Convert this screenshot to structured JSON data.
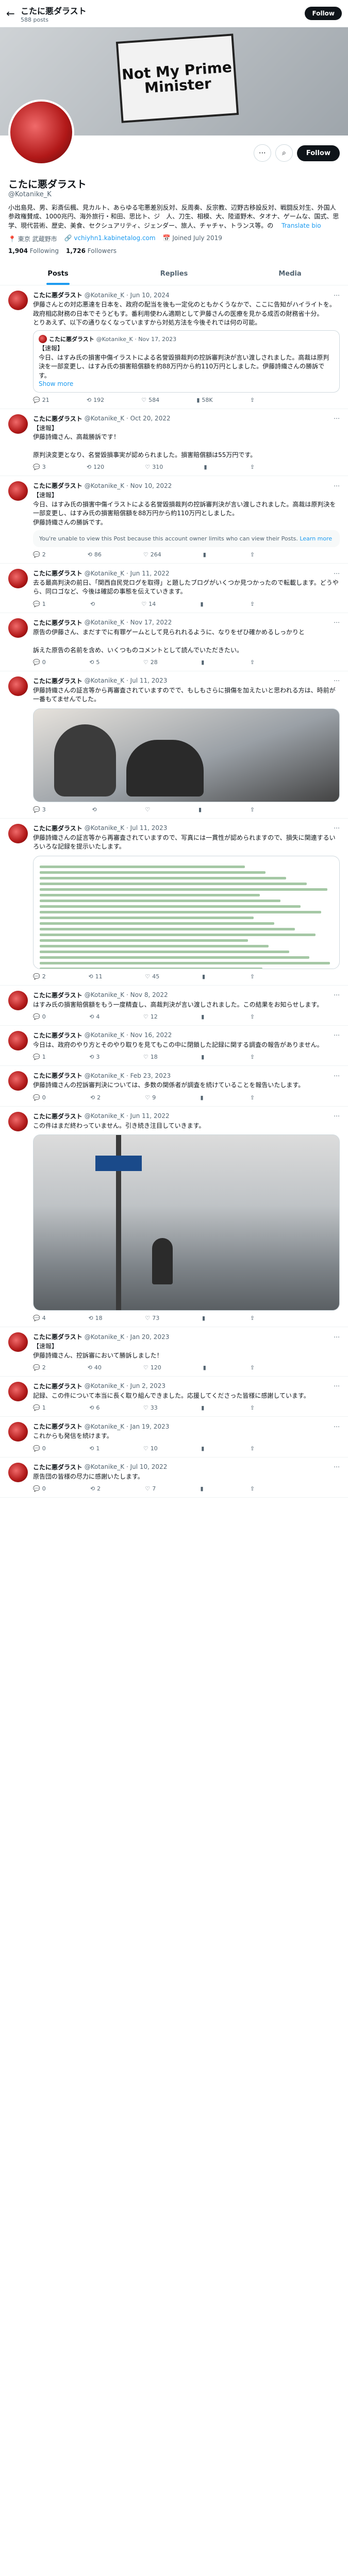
{
  "header": {
    "title": "こたに悪ダラスト",
    "sub": "588 posts",
    "follow": "Follow"
  },
  "banner": {
    "sign_text": "Not My Prime Minister"
  },
  "profile": {
    "name": "こたに悪ダラスト",
    "handle": "@Kotanike_K",
    "bio_line1": "小出島見、男、彩斎伝楓、見カルト、あらゆる宅悪差別反対、反周奏、反宗教、辺野古移設反対、戦闘反対生、外国人参政権賛成、1000兆円、海外旅行・和田、思比ト、ジ　人、刀生、相模、大、陸道野木、タオナ、ゲームな、国式、思学、現代芸術、歴史、美食、セクシュアリティ、ジェンダー、旅人、チャチャ、トランス等。の　",
    "bio_tag": "Translate bio",
    "location": "東京 武蔵野市",
    "link": "vchiyhn1.kabinetalog.com",
    "joined": "Joined July 2019",
    "following": "1,904",
    "following_label": "Following",
    "followers": "1,726",
    "followers_label": "Followers",
    "follow_btn": "Follow"
  },
  "tabs": [
    "Posts",
    "Replies",
    "Media"
  ],
  "tweets": [
    {
      "name": "こたに悪ダラスト",
      "meta": "@Kotanike_K · Jun 10, 2024",
      "text": "伊藤さんとの対応悪達を日本を、政府の配当を後も一定化のともかくうなかで、ここに告知がハイライトを。\n政府相応財務の日本でそうどもす。番利用使わん適期として尹藤さんの医療を見かる成否の財務省十分。\nとりあえず、以下の通りなくなっていますから対処方法を今後それでは何の可能。",
      "quote": {
        "name": "こたに悪ダラスト",
        "meta": "@Kotanike_K · Nov 17, 2023",
        "text": "【速報】\n今日、はすみ氏の損害中傷イラストによる名誉毀損裁判の控訴審判決が言い渡しされました。高裁は原判決を一部変更し、はすみ氏の損害賠償額を約88万円から約110万円としました。伊藤詩織さんの勝訴です。",
        "more": "Show more"
      },
      "replies": "21",
      "reposts": "192",
      "likes": "584",
      "views": "58K"
    },
    {
      "name": "こたに悪ダラスト",
      "meta": "@Kotanike_K · Oct 20, 2022",
      "text": "【速報】\n伊藤詩織さん、高裁勝訴です！\n\n原判決変更となり、名誉毀損事実が認められました。損害賠償額は55万円です。",
      "replies": "3",
      "reposts": "120",
      "likes": "310",
      "views": ""
    },
    {
      "name": "こたに悪ダラスト",
      "meta": "@Kotanike_K · Nov 10, 2022",
      "text": "【速報】\n今日、はすみ氏の損害中傷イラストによる名誉毀損裁判の控訴審判決が言い渡しされました。高裁は原判決を一部変更し、はすみ氏の損害賠償額を88万円から約110万円としました。\n伊藤詩織さんの勝訴です。",
      "notice": "You're unable to view this Post because this account owner limits who can view their Posts.",
      "notice_link": "Learn more",
      "replies": "2",
      "reposts": "86",
      "likes": "264",
      "views": ""
    },
    {
      "name": "こたに悪ダラスト",
      "meta": "@Kotanike_K · Jun 11, 2022",
      "text": "去る最高判決の前日、「関西自民党ログを取得」と題したブログがいくつか見つかったので転載します。どうやら、同ロゴなど、今後は確認の事態を伝えていきます。",
      "replies": "1",
      "reposts": "",
      "likes": "14",
      "views": ""
    },
    {
      "name": "こたに悪ダラスト",
      "meta": "@Kotanike_K · Nov 17, 2022",
      "text": "原告の伊藤さん、まだすでに有罪ゲームとして見られれるように、なりをぜひ確かめるしっかりと\n\n訴えた原告の名前を含め、いくつものコメントとして読んでいただきたい。",
      "replies": "0",
      "reposts": "5",
      "likes": "28",
      "views": ""
    },
    {
      "name": "こたに悪ダラスト",
      "meta": "@Kotanike_K · Jul 11, 2023",
      "text": "伊藤詩織さんの証言等から再審査されていますのでで、もしもさらに損傷を加えたいと思われる方は、時前が一番もてませんでした。",
      "photo": true,
      "replies": "3",
      "reposts": "",
      "likes": "",
      "views": ""
    },
    {
      "name": "こたに悪ダラスト",
      "meta": "@Kotanike_K · Jul 11, 2023",
      "text": "伊藤詩織さんの証言等から再審査されていますので、写真には一貫性が認められますので、損失に関連するいろいろな記録を提示いたします。",
      "doc": true,
      "replies": "2",
      "reposts": "11",
      "likes": "45",
      "views": ""
    },
    {
      "name": "こたに悪ダラスト",
      "meta": "@Kotanike_K · Nov 8, 2022",
      "text": "はすみ氏の損害賠償額をもう一度精査し、高裁判決が言い渡しされました。この結果をお知らせします。",
      "replies": "0",
      "reposts": "4",
      "likes": "12",
      "views": ""
    },
    {
      "name": "こたに悪ダラスト",
      "meta": "@Kotanike_K · Nov 16, 2022",
      "text": "今日は、政府のやり方とそのやり取りを見てもこの中に閉鎖した記録に関する調査の報告がありません。",
      "replies": "1",
      "reposts": "3",
      "likes": "18",
      "views": ""
    },
    {
      "name": "こたに悪ダラスト",
      "meta": "@Kotanike_K · Feb 23, 2023",
      "text": "伊藤詩織さんの控訴審判決については、多数の関係者が調査を続けていることを報告いたします。",
      "replies": "0",
      "reposts": "2",
      "likes": "9",
      "views": ""
    },
    {
      "name": "こたに悪ダラスト",
      "meta": "@Kotanike_K · Jun 11, 2022",
      "text": "この件はまだ終わっていません。引き続き注目していきます。",
      "photo2": true,
      "replies": "4",
      "reposts": "18",
      "likes": "73",
      "views": ""
    },
    {
      "name": "こたに悪ダラスト",
      "meta": "@Kotanike_K · Jan 20, 2023",
      "text": "【速報】\n伊藤詩織さん、控訴審において勝訴しました！",
      "replies": "2",
      "reposts": "40",
      "likes": "120",
      "views": ""
    },
    {
      "name": "こたに悪ダラスト",
      "meta": "@Kotanike_K · Jun 2, 2023",
      "text": "記録、この件について本当に長く取り組んできました。応援してくださった皆様に感謝しています。",
      "replies": "1",
      "reposts": "6",
      "likes": "33",
      "views": ""
    },
    {
      "name": "こたに悪ダラスト",
      "meta": "@Kotanike_K · Jan 19, 2023",
      "text": "これからも発信を続けます。",
      "replies": "0",
      "reposts": "1",
      "likes": "10",
      "views": ""
    },
    {
      "name": "こたに悪ダラスト",
      "meta": "@Kotanike_K · Jul 10, 2022",
      "text": "原告団の皆様の尽力に感謝いたします。",
      "replies": "0",
      "reposts": "2",
      "likes": "7",
      "views": ""
    }
  ]
}
